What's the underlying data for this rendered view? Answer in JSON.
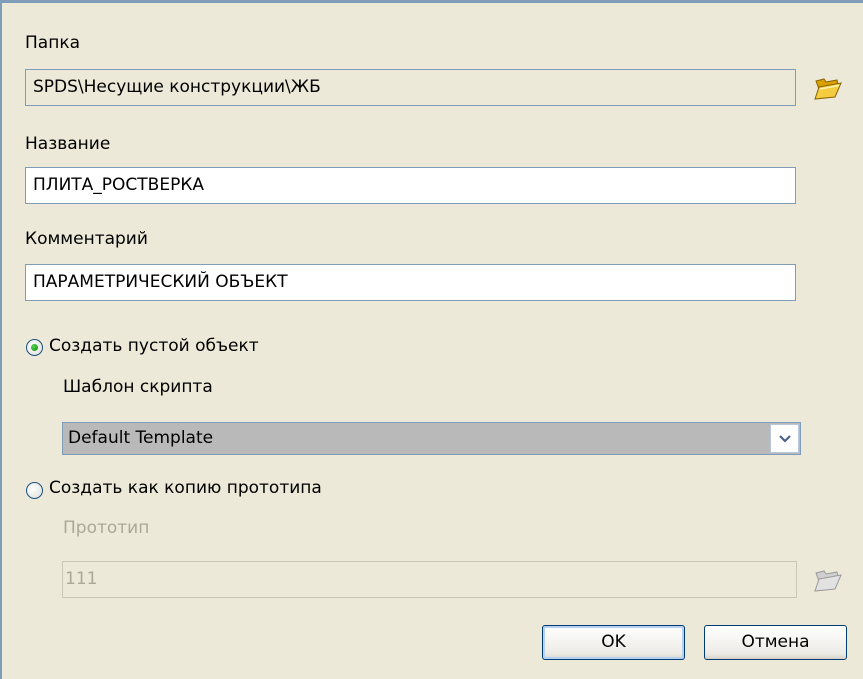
{
  "folder": {
    "label": "Папка",
    "value": "SPDS\\Несущие конструкции\\ЖБ",
    "browse_icon": "folder-open-icon"
  },
  "name": {
    "label": "Название",
    "value": "ПЛИТА_РОСТВЕРКА"
  },
  "comment": {
    "label": "Комментарий",
    "value": "ПАРАМЕТРИЧЕСКИЙ ОБЪЕКТ"
  },
  "create_empty": {
    "label": "Создать пустой объект",
    "selected": true
  },
  "script_template": {
    "label": "Шаблон скрипта",
    "selected": "Default Template"
  },
  "create_copy": {
    "label": "Создать как копию прототипа",
    "selected": false
  },
  "prototype": {
    "label": "Прототип",
    "value": "111",
    "browse_icon": "folder-open-icon"
  },
  "buttons": {
    "ok": "OK",
    "cancel": "Отмена"
  }
}
